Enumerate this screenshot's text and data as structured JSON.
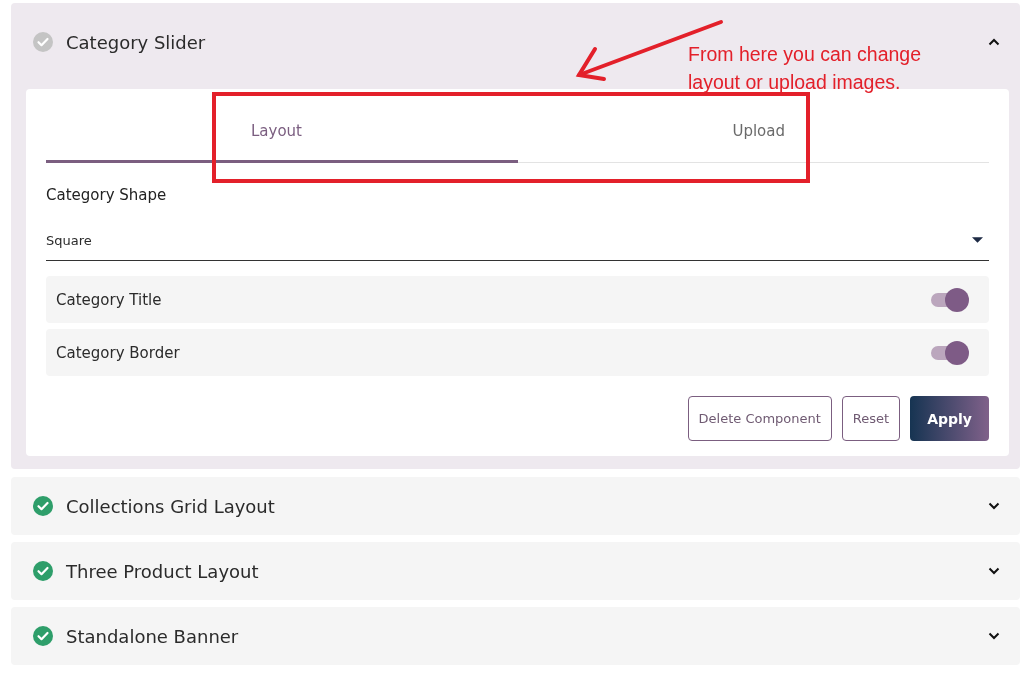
{
  "sections": [
    {
      "title": "Category Slider",
      "complete": false,
      "expanded": true,
      "tabs": [
        {
          "label": "Layout",
          "selected": true
        },
        {
          "label": "Upload",
          "selected": false
        }
      ],
      "field": {
        "label": "Category Shape",
        "value": "Square"
      },
      "toggles": [
        {
          "label": "Category Title",
          "on": true
        },
        {
          "label": "Category Border",
          "on": true
        }
      ],
      "buttons": [
        {
          "label": "Delete Component",
          "kind": "outline"
        },
        {
          "label": "Reset",
          "kind": "outline"
        },
        {
          "label": "Apply",
          "kind": "primary"
        }
      ]
    },
    {
      "title": "Collections Grid Layout",
      "complete": true,
      "expanded": false
    },
    {
      "title": "Three Product Layout",
      "complete": true,
      "expanded": false
    },
    {
      "title": "Standalone Banner",
      "complete": true,
      "expanded": false
    }
  ],
  "annotation": {
    "text": "From here you can change layout or upload images."
  }
}
